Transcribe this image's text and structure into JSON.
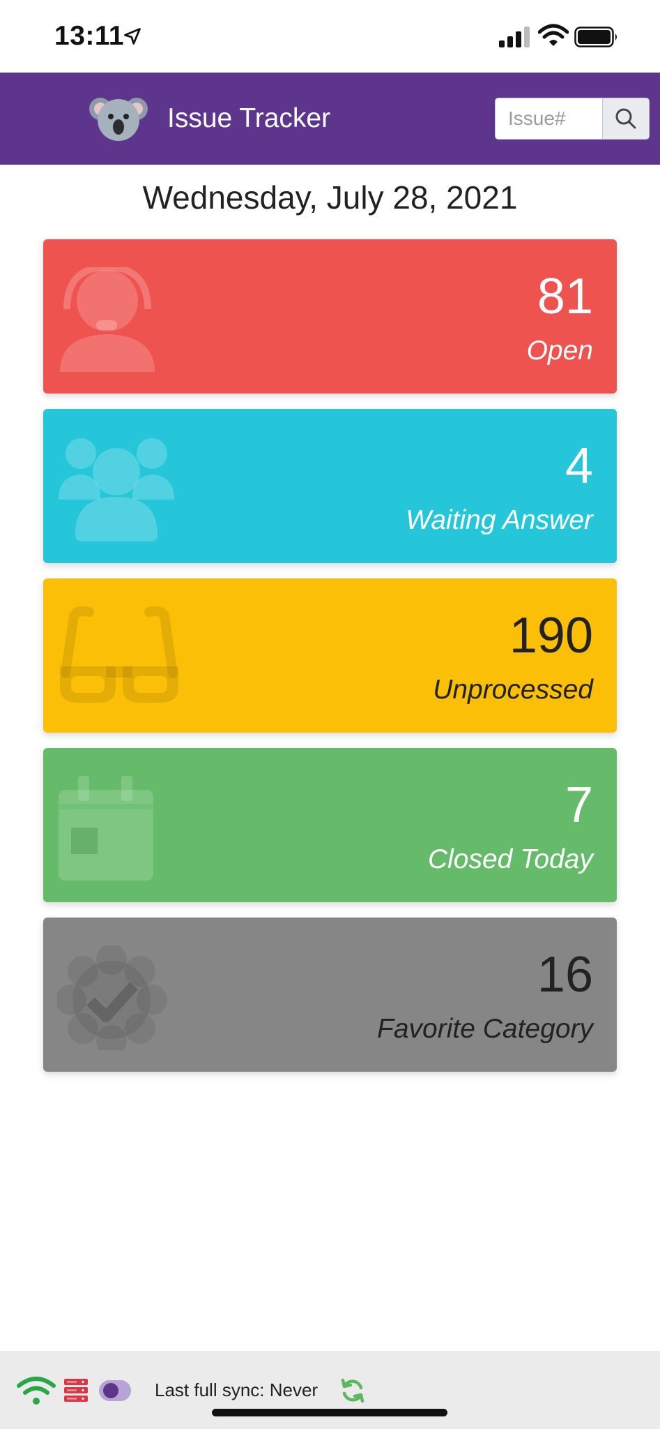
{
  "status_bar": {
    "time": "13:11",
    "icons": [
      "location-arrow-icon",
      "cellular-signal-icon",
      "wifi-icon",
      "battery-icon"
    ]
  },
  "header": {
    "title": "Issue Tracker",
    "logo_icon": "koala-icon",
    "search": {
      "placeholder": "Issue#",
      "value": "",
      "button_icon": "search-icon"
    },
    "background_color": "#5e358d"
  },
  "date": "Wednesday, July 28, 2021",
  "cards": [
    {
      "count": "81",
      "label": "Open",
      "icon": "support-agent-icon",
      "color": "#ef5350"
    },
    {
      "count": "4",
      "label": "Waiting Answer",
      "icon": "users-group-icon",
      "color": "#26c6da"
    },
    {
      "count": "190",
      "label": "Unprocessed",
      "icon": "glasses-icon",
      "color": "#fcbf08"
    },
    {
      "count": "7",
      "label": "Closed Today",
      "icon": "calendar-day-icon",
      "color": "#66bb6a"
    },
    {
      "count": "16",
      "label": "Favorite Category",
      "icon": "certificate-check-icon",
      "color": "#868686"
    }
  ],
  "footer": {
    "sync_text": "Last full sync: Never",
    "icons": [
      "wifi-status-icon",
      "server-icon",
      "toggle-switch",
      "sync-icon"
    ],
    "wifi_color": "#28a745",
    "server_color": "#dc3545",
    "sync_color": "#5cb85c"
  }
}
